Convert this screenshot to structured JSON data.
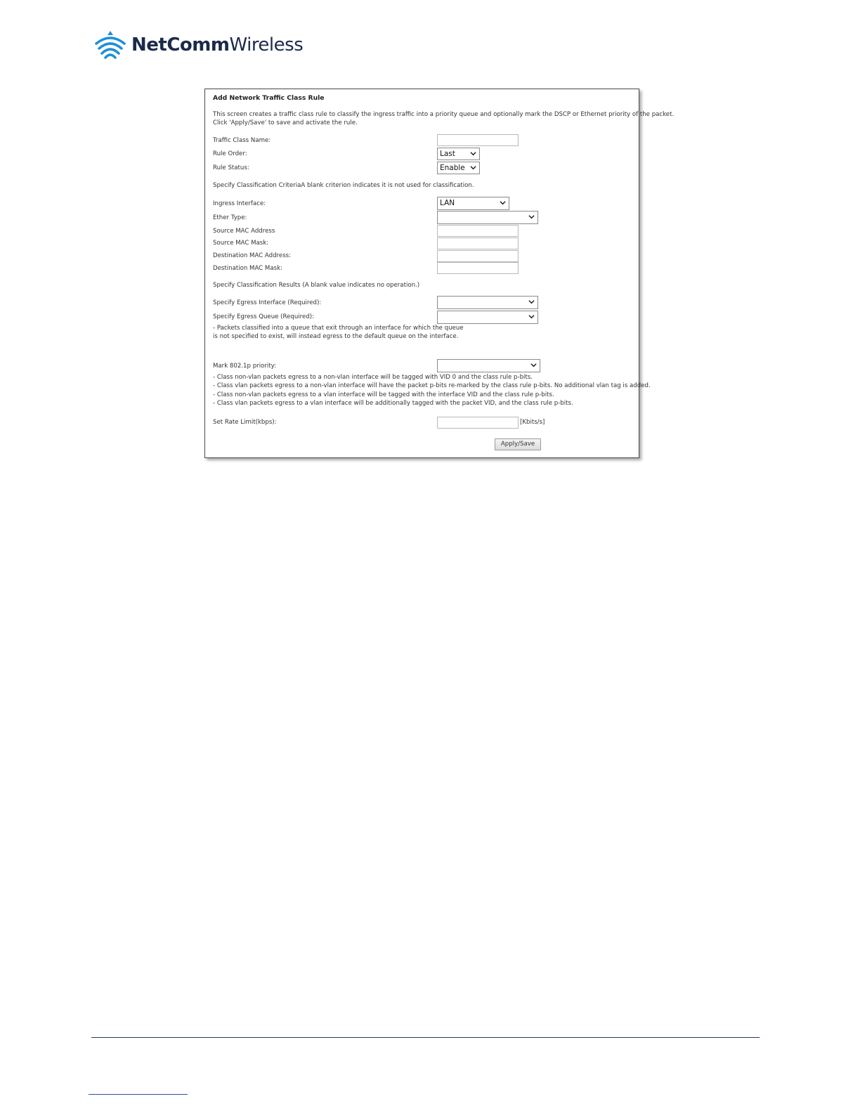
{
  "brand": {
    "name_bold": "NetComm",
    "name_regular": "Wireless"
  },
  "form": {
    "title": "Add Network Traffic Class Rule",
    "intro_line1": "This screen creates a traffic class rule to classify the ingress traffic into a priority queue and optionally mark the DSCP or Ethernet priority of the packet.",
    "intro_line2": "Click 'Apply/Save' to save and activate the rule.",
    "traffic_class_name_label": "Traffic Class Name:",
    "traffic_class_name_value": "",
    "rule_order_label": "Rule Order:",
    "rule_order_value": "Last",
    "rule_status_label": "Rule Status:",
    "rule_status_value": "Enable",
    "criteria_heading": "Specify Classification Criteria",
    "criteria_note": "A blank criterion indicates it is not used for classification.",
    "ingress_interface_label": "Ingress Interface:",
    "ingress_interface_value": "LAN",
    "ether_type_label": "Ether Type:",
    "ether_type_value": "",
    "source_mac_address_label": "Source MAC Address",
    "source_mac_mask_label": "Source MAC Mask:",
    "dest_mac_address_label": "Destination MAC Address:",
    "dest_mac_mask_label": "Destination MAC Mask:",
    "results_heading": "Specify Classification Results",
    "results_note": " (A blank value indicates no operation.)",
    "egress_interface_label": "Specify Egress Interface (Required):",
    "egress_queue_label": "Specify Egress Queue (Required):",
    "queue_note_line1": "- Packets classified into a queue that exit through an interface for which the queue",
    "queue_note_line2": "is not specified to exist, will instead egress to the default queue on the interface.",
    "mark_8021p_label": "Mark 802.1p priority:",
    "vlan_note_1": "- Class non-vlan packets egress to a non-vlan interface will be tagged with VID 0 and the class rule p-bits.",
    "vlan_note_2": "- Class vlan packets egress to a non-vlan interface will have the packet p-bits re-marked by the class rule p-bits. No additional vlan tag is added.",
    "vlan_note_3": "- Class non-vlan packets egress to a vlan interface will be tagged with the interface VID and the class rule p-bits.",
    "vlan_note_4": "- Class vlan packets egress to a vlan interface will be additionally tagged with the packet VID, and the class rule p-bits.",
    "rate_limit_label": "Set Rate Limit(kbps):",
    "rate_limit_unit": "[Kbits/s]",
    "apply_button": "Apply/Save"
  },
  "colors": {
    "brand_navy": "#1c2a4a",
    "brand_blue": "#1e8fd6",
    "footer_rule": "#1f3a5f"
  }
}
